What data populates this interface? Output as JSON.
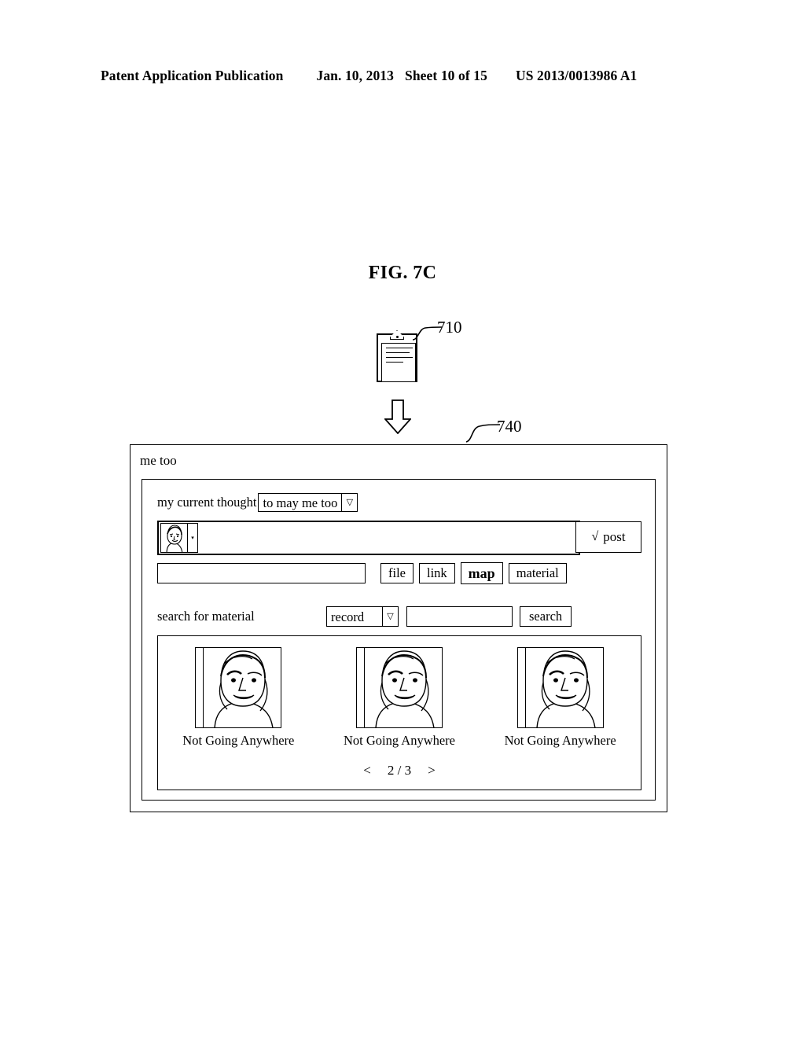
{
  "header": {
    "publication": "Patent Application Publication",
    "date": "Jan. 10, 2013",
    "sheet": "Sheet 10 of 15",
    "number": "US 2013/0013986 A1"
  },
  "figure": {
    "title": "FIG. 7C",
    "ref_clipboard": "710",
    "ref_window": "740",
    "clipboard_icon": "clipboard-icon",
    "flow_arrow_icon": "down-arrow-icon"
  },
  "window": {
    "title": "me too",
    "thought": {
      "label": "my current thought",
      "selected": "to may me too",
      "arrow": "▽"
    },
    "compose": {
      "avatar_icon": "avatar-face-icon",
      "avatar_tag_arrow": "▾",
      "text_value": "",
      "post_check": "√",
      "post_label": "post"
    },
    "attach": {
      "input_value": "",
      "buttons": [
        {
          "label": "file",
          "emphasis": false
        },
        {
          "label": "link",
          "emphasis": false
        },
        {
          "label": "map",
          "emphasis": true
        },
        {
          "label": "material",
          "emphasis": false
        }
      ]
    },
    "search": {
      "label": "search for material",
      "type_selected": "record",
      "type_arrow": "▽",
      "query_value": "",
      "button_label": "search"
    },
    "results": {
      "items": [
        {
          "caption": "Not Going Anywhere",
          "thumb_icon": "portrait-thumbnail-icon"
        },
        {
          "caption": "Not Going Anywhere",
          "thumb_icon": "portrait-thumbnail-icon"
        },
        {
          "caption": "Not Going Anywhere",
          "thumb_icon": "portrait-thumbnail-icon"
        }
      ],
      "pagination": {
        "prev": "<",
        "position": "2 / 3",
        "next": ">"
      }
    }
  }
}
